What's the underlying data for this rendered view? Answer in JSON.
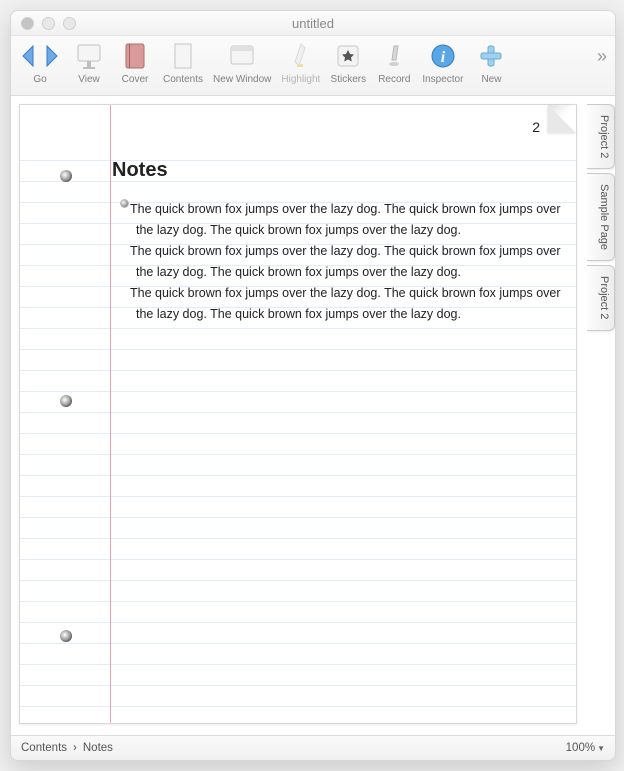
{
  "window": {
    "title": "untitled"
  },
  "toolbar": {
    "items": [
      {
        "id": "go",
        "label": "Go"
      },
      {
        "id": "view",
        "label": "View"
      },
      {
        "id": "cover",
        "label": "Cover"
      },
      {
        "id": "contents",
        "label": "Contents"
      },
      {
        "id": "new-window",
        "label": "New Window"
      },
      {
        "id": "highlight",
        "label": "Highlight"
      },
      {
        "id": "stickers",
        "label": "Stickers"
      },
      {
        "id": "record",
        "label": "Record"
      },
      {
        "id": "inspector",
        "label": "Inspector"
      },
      {
        "id": "new",
        "label": "New"
      }
    ]
  },
  "page": {
    "number": "2",
    "heading": "Notes",
    "paragraphs": [
      "The quick brown fox jumps over the lazy dog.  The quick brown fox jumps over the lazy dog.  The quick brown fox jumps over the lazy dog.",
      "The quick brown fox jumps over the lazy dog.  The quick brown fox jumps over the lazy dog.  The quick brown fox jumps over the lazy dog.",
      "The quick brown fox jumps over the lazy dog.  The quick brown fox jumps over the lazy dog.  The quick brown fox jumps over the lazy dog."
    ]
  },
  "side_tabs": [
    "Project 2",
    "Sample Page",
    "Project 2"
  ],
  "statusbar": {
    "breadcrumb": [
      "Contents",
      "Notes"
    ],
    "separator": "›",
    "zoom": "100%"
  }
}
